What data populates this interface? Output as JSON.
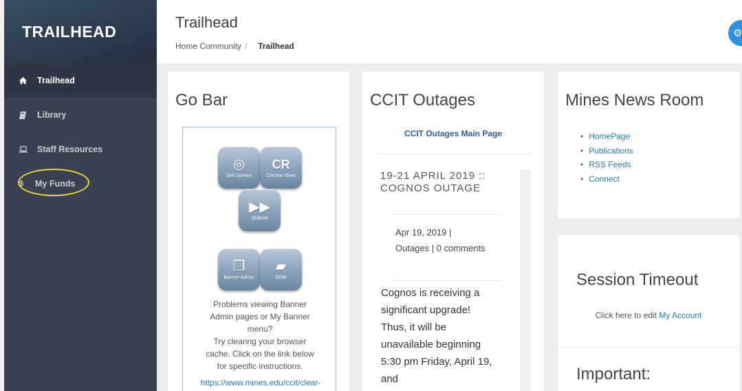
{
  "sidebar": {
    "brand": "TRAILHEAD",
    "items": [
      {
        "label": "Trailhead",
        "icon": "home-icon"
      },
      {
        "label": "Library",
        "icon": "book-icon"
      },
      {
        "label": "Staff Resources",
        "icon": "laptop-icon"
      },
      {
        "label": "My Funds",
        "icon": "dollar-icon"
      }
    ]
  },
  "header": {
    "title": "Trailhead",
    "breadcrumb": {
      "home": "Home Community",
      "separator": "/",
      "current": "Trailhead"
    }
  },
  "gobar": {
    "title": "Go Bar",
    "apps": [
      {
        "label": "Self Service",
        "icon": "target-icon"
      },
      {
        "label": "Chrome River",
        "icon": "chrome-river-icon"
      },
      {
        "label": "Skillsoft",
        "icon": "play-icon"
      },
      {
        "label": "Banner Admin",
        "icon": "documents-icon"
      },
      {
        "label": "BDM",
        "icon": "folder-icon"
      }
    ],
    "help_line1": "Problems viewing Banner Admin pages or My Banner menu?",
    "help_line2": "Try clearing your browser cache.  Click on the link below for specific instructions.",
    "link": "https://www.mines.edu/ccit/clear-"
  },
  "outages": {
    "title": "CCIT Outages",
    "main_link": "CCIT Outages Main Page",
    "post": {
      "title": "19-21 APRIL 2019 :: COGNOS OUTAGE",
      "date": "Apr 19, 2019 |",
      "category": "Outages",
      "comments": "| 0 comments",
      "body": "Cognos is receiving a significant upgrade! Thus, it will be unavailable beginning 5:30 pm Friday, April 19, and"
    }
  },
  "news": {
    "title": "Mines News Room",
    "links": [
      "HomePage",
      "Publications",
      "RSS Feeds",
      "Connect"
    ]
  },
  "session": {
    "title": "Session Timeout",
    "text": "Click here to edit",
    "link": "My Account"
  },
  "important": {
    "title": "Important:"
  },
  "colors": {
    "sidebar": "#3a4250",
    "accent": "#2f8fe0",
    "link": "#2a7ab8",
    "highlight": "#e8d93a"
  }
}
